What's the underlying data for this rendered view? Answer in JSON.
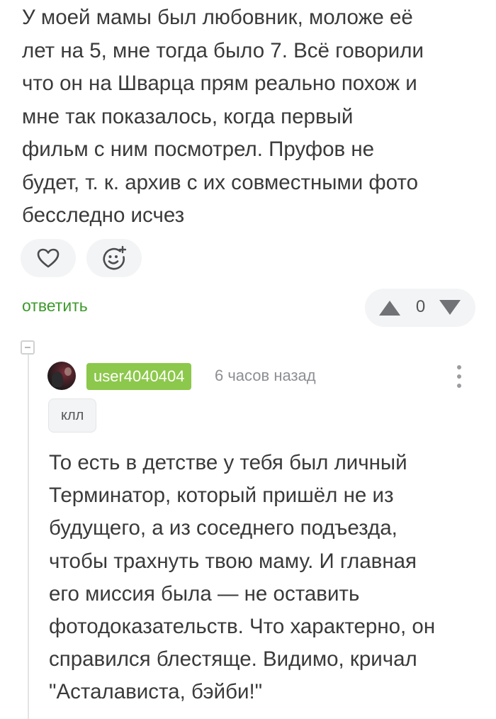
{
  "parent_comment": {
    "text_lines": [
      "У моей мамы был любовник, моложе её",
      "лет на 5, мне тогда было 7. Всё говорили",
      "что он на Шварца прям реально похож и",
      "мне так показалось, когда первый",
      "фильм с ним посмотрел. Пруфов не",
      "будет, т. к. архив с их совместными фото",
      "бесследно исчез"
    ],
    "reply_label": "ответить",
    "vote_count": "0"
  },
  "reactions": {
    "like_icon": "heart-icon",
    "add_reaction_icon": "emoji-plus-icon"
  },
  "reply_comment": {
    "username": "user4040404",
    "timestamp": "6 часов назад",
    "tag": "клл",
    "text_lines": [
      "То есть в детстве у тебя был личный",
      "Терминатор, который пришёл не из",
      "будущего, а из соседнего подъезда,",
      "чтобы трахнуть твою маму. И главная",
      "его миссия была — не оставить",
      "фотодоказательств. Что характерно, он",
      "справился блестяще. Видимо, кричал",
      "\"Асталависта, бэйби!\""
    ]
  },
  "colors": {
    "accent_green": "#3d9a2c",
    "badge_green": "#8cc84b",
    "button_bg": "#f3f4f5",
    "text": "#3a3a3a",
    "muted": "#8d8f93"
  }
}
